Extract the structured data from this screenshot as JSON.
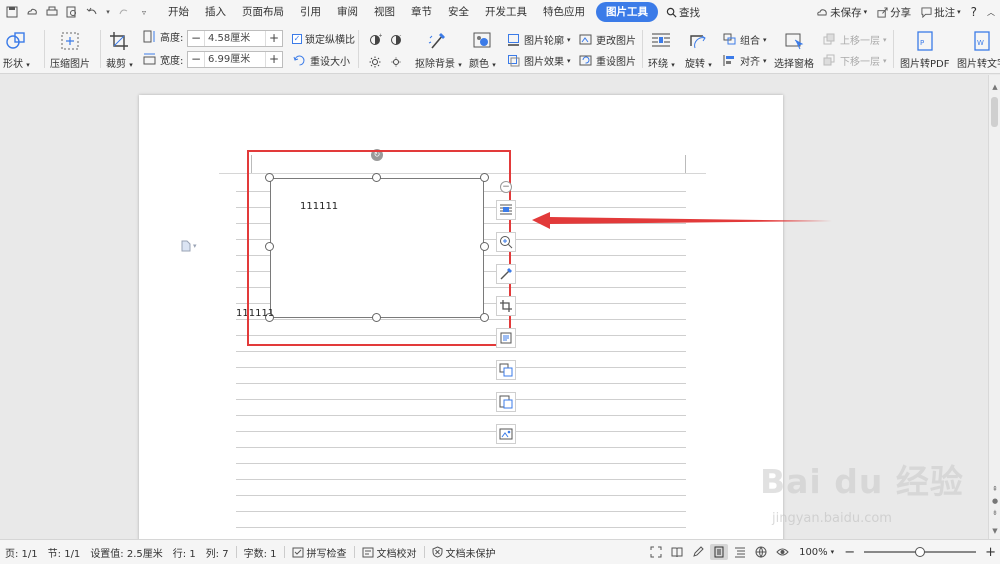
{
  "menubar": {
    "tabs": [
      "开始",
      "插入",
      "页面布局",
      "引用",
      "审阅",
      "视图",
      "章节",
      "安全",
      "开发工具",
      "特色应用",
      "图片工具"
    ],
    "active_tab": "图片工具",
    "search_label": "查找",
    "unsaved_label": "未保存",
    "share_label": "分享",
    "comment_label": "批注",
    "help_label": "?"
  },
  "ribbon": {
    "shape_label": "形状",
    "compress_label": "压缩图片",
    "crop_label": "裁剪",
    "height_label": "高度:",
    "height_value": "4.58厘米",
    "width_label": "宽度:",
    "width_value": "6.99厘米",
    "lock_ratio_label": "锁定纵横比",
    "reset_size_label": "重设大小",
    "remove_bg_label": "抠除背景",
    "color_label": "颜色",
    "outline_label": "图片轮廓",
    "effect_label": "图片效果",
    "change_label": "更改图片",
    "reset_pic_label": "重设图片",
    "wrap_label": "环绕",
    "rotate_label": "旋转",
    "group_label": "组合",
    "align_label": "对齐",
    "selection_pane_label": "选择窗格",
    "bring_forward_label": "上移一层",
    "send_backward_label": "下移一层",
    "to_pdf_label": "图片转PDF",
    "to_text_label": "图片转文字",
    "plus_sign": "+",
    "minus_sign": "−"
  },
  "document": {
    "text_in_image": "111111",
    "text_below_image": "111111"
  },
  "watermark": {
    "brand": "Bai du 经验",
    "site": "jingyan.baidu.com"
  },
  "statusbar": {
    "page": "页: 1/1",
    "section": "节: 1/1",
    "setting": "设置值: 2.5厘米",
    "row": "行: 1",
    "col": "列: 7",
    "words": "字数: 1",
    "spell_check": "拼写检查",
    "doc_proof": "文档校对",
    "doc_protect": "文档未保护",
    "zoom": "100%",
    "zoom_fraction": 0.5,
    "zoom_minus": "−",
    "zoom_plus": "+"
  },
  "colors": {
    "accent": "#3b7be8",
    "highlight_red": "#e23a3a"
  }
}
